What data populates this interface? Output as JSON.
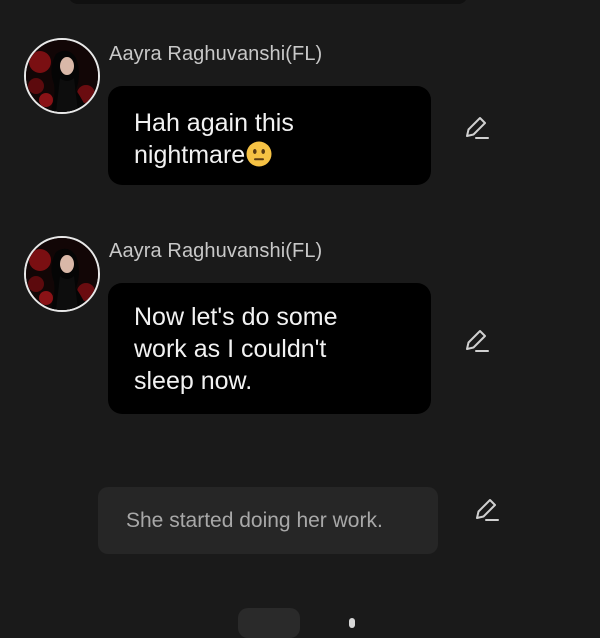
{
  "chat": {
    "messages": [
      {
        "sender": "Aayra Raghuvanshi(FL)",
        "text": "Hah again this\nnightmare",
        "emoji": "neutral-face-emoji",
        "edit_icon": "pencil-edit-icon"
      },
      {
        "sender": "Aayra Raghuvanshi(FL)",
        "text": "Now let's do some\nwork as I couldn't\nsleep now.",
        "edit_icon": "pencil-edit-icon"
      }
    ],
    "narration": {
      "text": "She started doing her work.",
      "edit_icon": "pencil-edit-icon"
    }
  },
  "colors": {
    "background": "#1a1a1a",
    "bubble": "#000000",
    "narration_bubble": "#262626",
    "sender_name": "#c8c8c8",
    "message_text": "#f2f2f2",
    "narration_text": "#a8a8a8",
    "icon": "#d0d0d0"
  }
}
